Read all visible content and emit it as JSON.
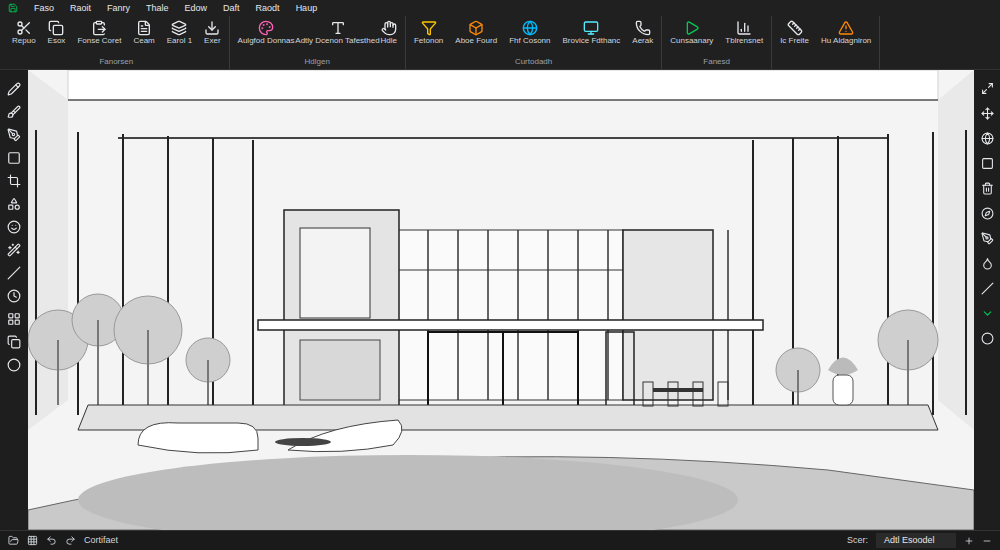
{
  "menu": [
    "Faso",
    "Raoit",
    "Fanry",
    "Thale",
    "Edow",
    "Daft",
    "Raodt",
    "Haup"
  ],
  "ribbon": [
    {
      "label": "Fanorsen",
      "buttons": [
        {
          "label": "Repuo"
        },
        {
          "label": "Esox"
        },
        {
          "label": "Fonse Coret"
        },
        {
          "label": "Ceam"
        },
        {
          "label": "Earol 1"
        },
        {
          "label": "Exer"
        }
      ]
    },
    {
      "label": "Hdlgen",
      "buttons": [
        {
          "label": "Aulgfod Donnas"
        },
        {
          "label": "Adtly Dcenon Tafesthed"
        },
        {
          "label": "Hdle"
        }
      ]
    },
    {
      "label": "Curtodadh",
      "buttons": [
        {
          "label": "Fetonon"
        },
        {
          "label": "Aboe Fourd"
        },
        {
          "label": "Fhf Cosonn"
        },
        {
          "label": "Brovice Fdthanc"
        },
        {
          "label": "Aerak"
        }
      ]
    },
    {
      "label": "Fanesd",
      "buttons": [
        {
          "label": "Cunsaanary"
        },
        {
          "label": "Tblrensnet"
        }
      ]
    },
    {
      "label": "",
      "buttons": [
        {
          "label": "Ic Freite"
        },
        {
          "label": "Hu Aldagniron"
        }
      ]
    }
  ],
  "status_bar": {
    "left": "Cortifaet",
    "scene_label": "Scer:",
    "scene_value": "Adtl Esoodel"
  }
}
